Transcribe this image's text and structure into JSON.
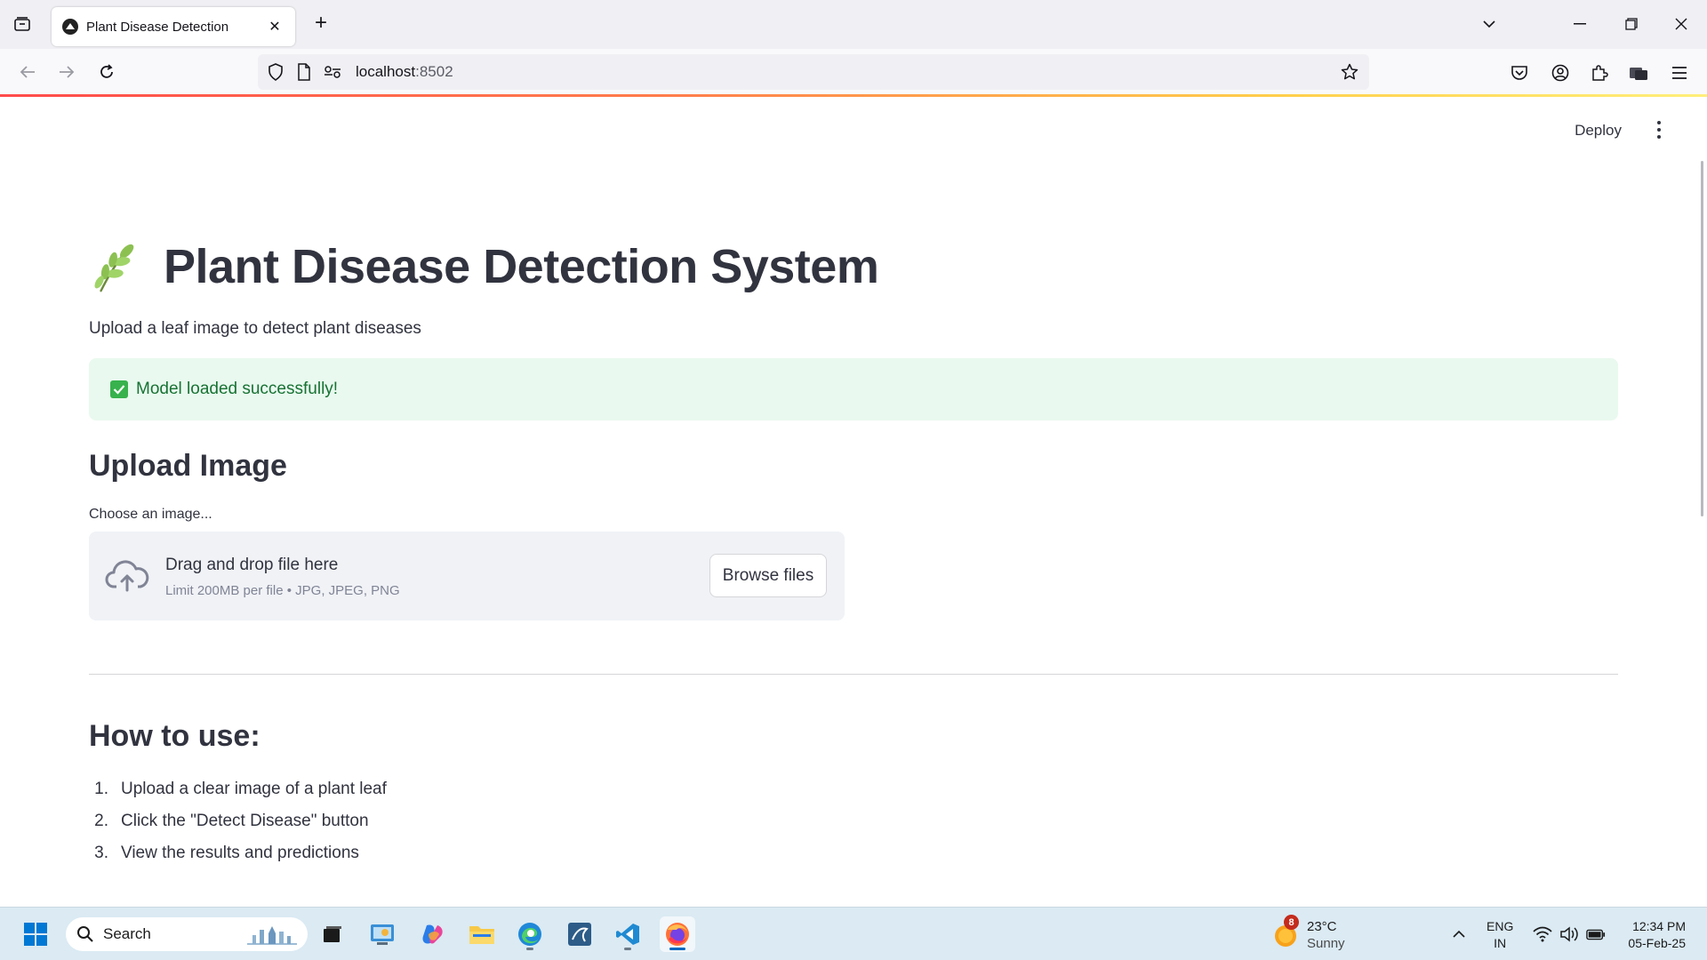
{
  "browser": {
    "tab_title": "Plant Disease Detection",
    "url_host": "localhost",
    "url_port": ":8502"
  },
  "app": {
    "deploy_label": "Deploy",
    "title_emoji": "leaf-icon",
    "title": "Plant Disease Detection System",
    "subtitle": "Upload a leaf image to detect plant diseases",
    "success_message": "Model loaded successfully!",
    "upload_heading": "Upload Image",
    "uploader_label": "Choose an image...",
    "dropzone_main": "Drag and drop file here",
    "dropzone_sub": "Limit 200MB per file • JPG, JPEG, PNG",
    "browse_label": "Browse files",
    "howto_heading": "How to use:",
    "steps": [
      {
        "num": "1.",
        "text": "Upload a clear image of a plant leaf"
      },
      {
        "num": "2.",
        "text": "Click the \"Detect Disease\" button"
      },
      {
        "num": "3.",
        "text": "View the results and predictions"
      }
    ]
  },
  "taskbar": {
    "search_placeholder": "Search",
    "weather_temp": "23°C",
    "weather_desc": "Sunny",
    "weather_badge": "8",
    "lang_line1": "ENG",
    "lang_line2": "IN",
    "time": "12:34 PM",
    "date": "05-Feb-25"
  },
  "colors": {
    "accent": "#ff4b4b",
    "success_bg": "#e9f9ef",
    "success_text": "#177233",
    "text": "#31333f"
  }
}
